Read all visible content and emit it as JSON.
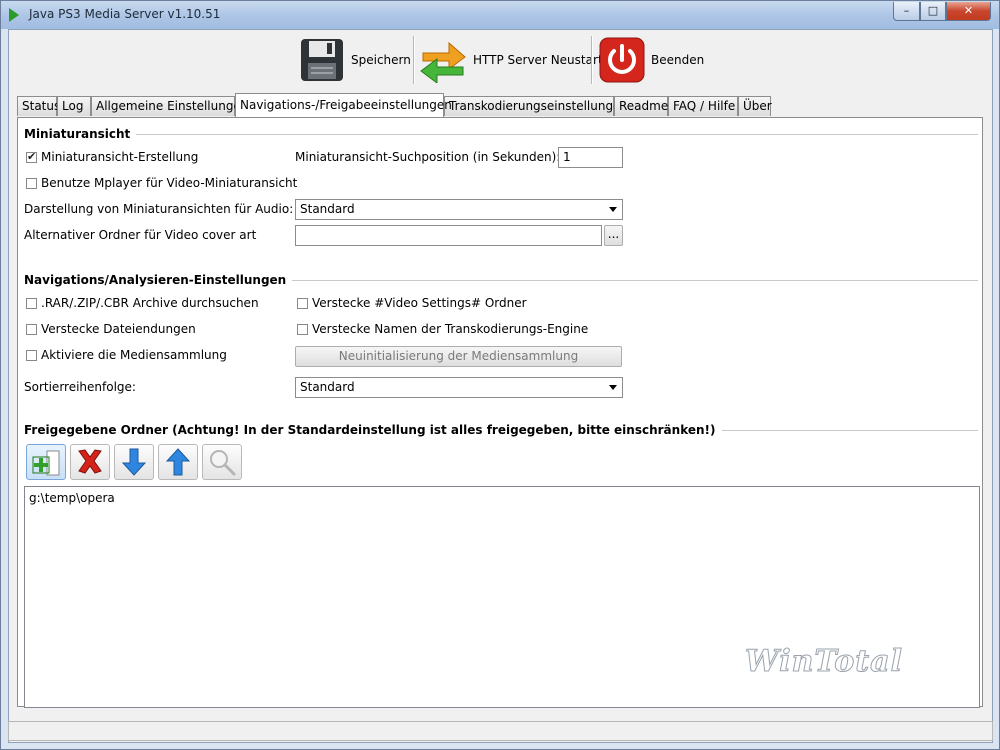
{
  "window": {
    "title": "Java PS3 Media Server v1.10.51",
    "min": "–",
    "max": "□",
    "close": "✕"
  },
  "toolbar": {
    "save": "Speichern",
    "restart": "HTTP Server Neustart",
    "quit": "Beenden"
  },
  "tabs": [
    "Status",
    "Log",
    "Allgemeine Einstellungen",
    "Navigations-/Freigabeeinstellungen",
    "Transkodierungseinstellungen",
    "Readme",
    "FAQ / Hilfe",
    "Über"
  ],
  "thumbnails": {
    "section_title": "Miniaturansicht",
    "create_label": "Miniaturansicht-Erstellung",
    "create_checked": true,
    "seek_label": "Miniaturansicht-Suchposition (in Sekunden):",
    "seek_value": "1",
    "mplayer_label": "Benutze Mplayer für Video-Miniaturansicht",
    "audio_label": "Darstellung von Miniaturansichten für Audio:",
    "audio_value": "Standard",
    "cover_label": "Alternativer Ordner für Video cover art",
    "cover_value": "",
    "browse_label": "..."
  },
  "navigation": {
    "section_title": "Navigations/Analysieren-Einstellungen",
    "archives_label": ".RAR/.ZIP/.CBR Archive durchsuchen",
    "hide_video_settings_label": "Verstecke #Video Settings# Ordner",
    "hide_extensions_label": "Verstecke Dateiendungen",
    "hide_engine_label": "Verstecke Namen der Transkodierungs-Engine",
    "media_library_label": "Aktiviere die Mediensammlung",
    "reinit_button": "Neuinitialisierung der Mediensammlung",
    "sort_label": "Sortierreihenfolge:",
    "sort_value": "Standard"
  },
  "shared": {
    "section_title": "Freigegebene Ordner (Achtung! In der Standardeinstellung ist alles freigegeben, bitte einschränken!)",
    "folders": [
      "g:\\temp\\opera"
    ]
  },
  "watermark": "WinTotal",
  "colors": {
    "accent": "#3a7cc9",
    "close": "#c9462d"
  }
}
